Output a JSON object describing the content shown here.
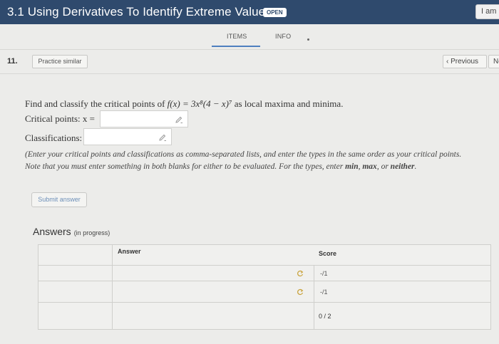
{
  "header": {
    "title": "3.1 Using Derivatives To Identify Extreme Values",
    "badge": "OPEN",
    "user_button": "I am",
    "colors": {
      "bar": "#2f4a6d",
      "accent": "#4d7fbf"
    }
  },
  "tabs": [
    {
      "label": "ITEMS",
      "active": true
    },
    {
      "label": "INFO",
      "active": false
    }
  ],
  "question": {
    "number": "11.",
    "practice_label": "Practice similar",
    "previous_label": "Previous",
    "next_label": "Ne",
    "prompt_pre": "Find and classify the critical points of ",
    "function_text": "f(x) = 3x⁸(4 − x)⁷",
    "prompt_post": " as local maxima and minima.",
    "critical_label": "Critical points: x =",
    "critical_value": "",
    "classifications_label": "Classifications:",
    "classifications_value": "",
    "instruction_line1": "(Enter your critical points and classifications as comma-separated lists, and enter the types in the same order as your critical points.",
    "instruction_line2_pre": "Note that you must enter something in both blanks for either to be evaluated. For the types, enter ",
    "instruction_kw1": "min",
    "instruction_kw2": "max",
    "instruction_kw3": "neither",
    "submit_label": "Submit answer"
  },
  "answers": {
    "title": "Answers",
    "status": "(in progress)",
    "columns": [
      "Answer",
      "Score"
    ],
    "rows": [
      {
        "score": "-/1",
        "icon": "refresh-icon"
      },
      {
        "score": "-/1",
        "icon": "refresh-icon"
      }
    ],
    "total": "0 / 2"
  }
}
